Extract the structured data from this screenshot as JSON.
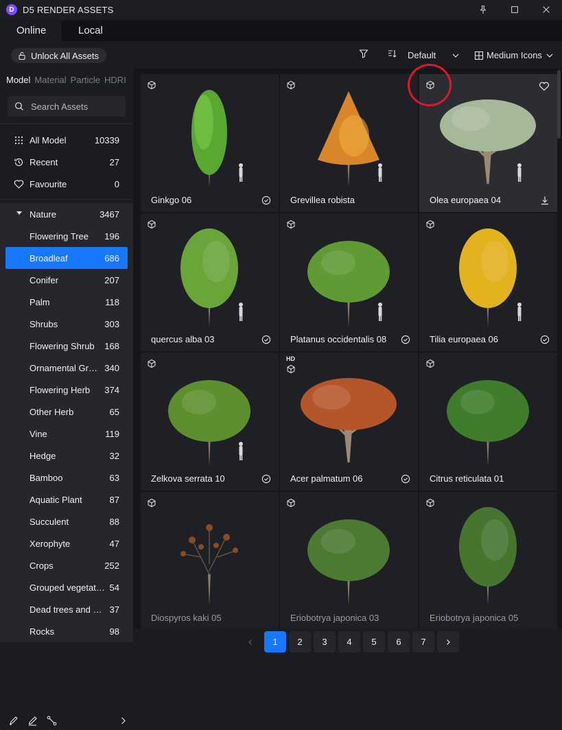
{
  "app": {
    "title": "D5 RENDER ASSETS",
    "logo_letter": "D"
  },
  "tabs": [
    {
      "label": "Online"
    },
    {
      "label": "Local"
    }
  ],
  "toolbar": {
    "unlock_label": "Unlock All Assets",
    "sort_label": "Default",
    "view_label": "Medium Icons"
  },
  "sidebar": {
    "categories": [
      "Model",
      "Material",
      "Particle",
      "HDRI"
    ],
    "search_placeholder": "Search Assets",
    "quick": [
      {
        "label": "All Model",
        "count": "10339",
        "icon": "grid-dots-icon"
      },
      {
        "label": "Recent",
        "count": "27",
        "icon": "history-icon"
      },
      {
        "label": "Favourite",
        "count": "0",
        "icon": "heart-icon"
      }
    ],
    "tree": [
      {
        "label": "Nature",
        "count": "3467",
        "parent": true
      },
      {
        "label": "Flowering Tree",
        "count": "196"
      },
      {
        "label": "Broadleaf",
        "count": "686",
        "selected": true
      },
      {
        "label": "Conifer",
        "count": "207"
      },
      {
        "label": "Palm",
        "count": "118"
      },
      {
        "label": "Shrubs",
        "count": "303"
      },
      {
        "label": "Flowering Shrub",
        "count": "168"
      },
      {
        "label": "Ornamental Grass",
        "count": "340"
      },
      {
        "label": "Flowering Herb",
        "count": "374"
      },
      {
        "label": "Other Herb",
        "count": "65"
      },
      {
        "label": "Vine",
        "count": "119"
      },
      {
        "label": "Hedge",
        "count": "32"
      },
      {
        "label": "Bamboo",
        "count": "63"
      },
      {
        "label": "Aquatic Plant",
        "count": "87"
      },
      {
        "label": "Succulent",
        "count": "88"
      },
      {
        "label": "Xerophyte",
        "count": "47"
      },
      {
        "label": "Crops",
        "count": "252"
      },
      {
        "label": "Grouped vegetation",
        "count": "54"
      },
      {
        "label": "Dead trees and stumps",
        "count": "37"
      },
      {
        "label": "Rocks",
        "count": "98"
      }
    ]
  },
  "assets": [
    {
      "name": "Ginkgo 06",
      "status": "downloaded",
      "foliage": "#5aa832",
      "shape": "narrow",
      "person": true
    },
    {
      "name": "Grevillea robista",
      "status": "none",
      "foliage": "#d9862a",
      "shape": "cone",
      "person": true
    },
    {
      "name": "Olea europaea  04",
      "status": "download",
      "foliage": "#a7b89a",
      "shape": "wide",
      "person": true,
      "hovered": true
    },
    {
      "name": "quercus alba 03",
      "status": "downloaded",
      "foliage": "#6aa53a",
      "shape": "oval",
      "person": true
    },
    {
      "name": "Platanus occidentalis 08",
      "status": "downloaded",
      "foliage": "#5f9a35",
      "shape": "round",
      "person": true
    },
    {
      "name": "Tilia europaea 06",
      "status": "downloaded",
      "foliage": "#e3b21f",
      "shape": "oval",
      "person": true
    },
    {
      "name": "Zelkova serrata 10",
      "status": "downloaded",
      "foliage": "#5e8f2e",
      "shape": "round",
      "person": true
    },
    {
      "name": "Acer palmatum 06",
      "status": "downloaded",
      "foliage": "#b4552a",
      "shape": "wide",
      "person": false,
      "hd": true
    },
    {
      "name": "Citrus reticulata 01",
      "status": "none",
      "foliage": "#3f7d2c",
      "shape": "round",
      "person": false
    },
    {
      "name": "Diospyros kaki 05",
      "status": "none",
      "foliage": "#8a4a22",
      "shape": "sparse",
      "person": false,
      "faded": true
    },
    {
      "name": "Eriobotrya japonica 03",
      "status": "none",
      "foliage": "#4c7a33",
      "shape": "round",
      "person": false,
      "faded": true
    },
    {
      "name": "Eriobotrya japonica 05",
      "status": "none",
      "foliage": "#46752f",
      "shape": "oval",
      "person": false,
      "faded": true
    }
  ],
  "pagination": {
    "pages": [
      "1",
      "2",
      "3",
      "4",
      "5",
      "6",
      "7"
    ],
    "current": "1"
  },
  "colors": {
    "accent": "#1677ff",
    "highlight": "#e0162b"
  }
}
